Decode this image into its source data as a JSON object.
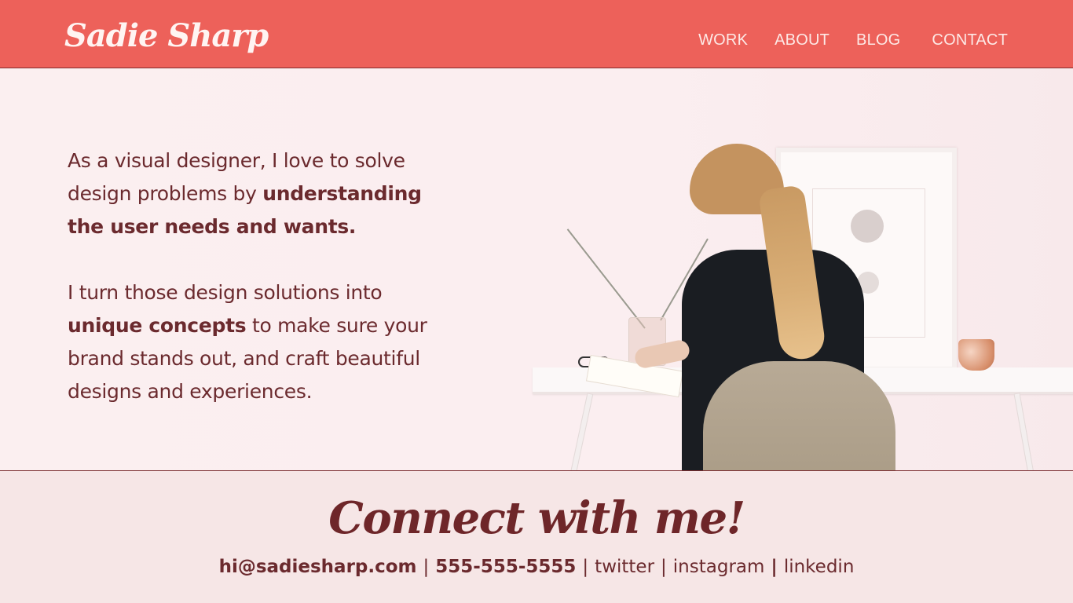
{
  "site": {
    "logo_text": "Sadie Sharp"
  },
  "nav": {
    "items": [
      {
        "label": "WORK"
      },
      {
        "label": "ABOUT"
      },
      {
        "label": "BLOG"
      },
      {
        "label": "CONTACT"
      }
    ]
  },
  "hero": {
    "paragraph1": {
      "lead": "As a visual designer, I love to solve design problems by",
      "emphasis": "understanding the user needs and wants."
    },
    "paragraph2": {
      "lead": "I turn those design solutions into",
      "emphasis": "unique concepts",
      "tail": "to make sure your brand stands out, and craft beautiful designs and experiences."
    },
    "image": {
      "description_icon": "woman-at-desk-photo"
    }
  },
  "footer": {
    "heading": "Connect with me!",
    "email": "hi@sadiesharp.com",
    "phone": "555-555-5555",
    "links": {
      "twitter": "twitter",
      "instagram": "instagram",
      "linkedin": "linkedin"
    },
    "separator": "|"
  },
  "colors": {
    "header_bg": "#ed615a",
    "accent_text": "#6b2a2e",
    "hero_bg": "#fbeff0",
    "footer_bg": "#f6e6e6"
  }
}
